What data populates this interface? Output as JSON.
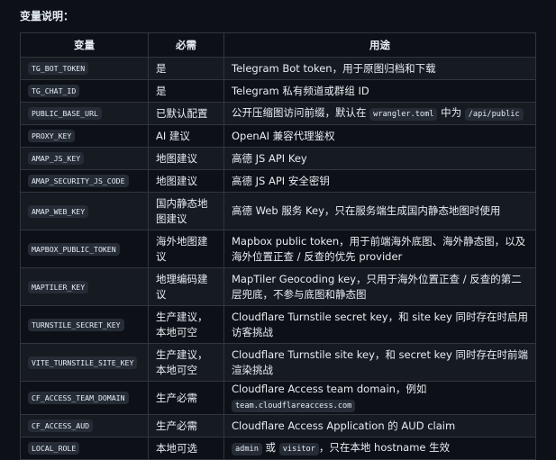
{
  "intro": "变量说明：",
  "headers": {
    "var": "变量",
    "req": "必需",
    "use": "用途"
  },
  "rows": [
    {
      "var": "TG_BOT_TOKEN",
      "req": "是",
      "use": [
        {
          "t": "Telegram Bot token，用于原图归档和下载"
        }
      ]
    },
    {
      "var": "TG_CHAT_ID",
      "req": "是",
      "use": [
        {
          "t": "Telegram 私有频道或群组 ID"
        }
      ]
    },
    {
      "var": "PUBLIC_BASE_URL",
      "req": "已默认配置",
      "use": [
        {
          "t": "公开压缩图访问前缀，默认在 "
        },
        {
          "c": "wrangler.toml"
        },
        {
          "t": " 中为 "
        },
        {
          "c": "/api/public"
        }
      ]
    },
    {
      "var": "PROXY_KEY",
      "req": "AI 建议",
      "use": [
        {
          "t": "OpenAI 兼容代理鉴权"
        }
      ]
    },
    {
      "var": "AMAP_JS_KEY",
      "req": "地图建议",
      "use": [
        {
          "t": "高德 JS API Key"
        }
      ]
    },
    {
      "var": "AMAP_SECURITY_JS_CODE",
      "req": "地图建议",
      "use": [
        {
          "t": "高德 JS API 安全密钥"
        }
      ]
    },
    {
      "var": "AMAP_WEB_KEY",
      "req": "国内静态地图建议",
      "use": [
        {
          "t": "高德 Web 服务 Key，只在服务端生成国内静态地图时使用"
        }
      ]
    },
    {
      "var": "MAPBOX_PUBLIC_TOKEN",
      "req": "海外地图建议",
      "use": [
        {
          "t": "Mapbox public token，用于前端海外底图、海外静态图，以及海外位置正查 / 反查的优先 provider"
        }
      ]
    },
    {
      "var": "MAPTILER_KEY",
      "req": "地理编码建议",
      "use": [
        {
          "t": "MapTiler Geocoding key，只用于海外位置正查 / 反查的第二层兜底，不参与底图和静态图"
        }
      ]
    },
    {
      "var": "TURNSTILE_SECRET_KEY",
      "req": "生产建议，本地可空",
      "use": [
        {
          "t": "Cloudflare Turnstile secret key，和 site key 同时存在时启用访客挑战"
        }
      ]
    },
    {
      "var": "VITE_TURNSTILE_SITE_KEY",
      "req": "生产建议，本地可空",
      "use": [
        {
          "t": "Cloudflare Turnstile site key，和 secret key 同时存在时前端渲染挑战"
        }
      ]
    },
    {
      "var": "CF_ACCESS_TEAM_DOMAIN",
      "req": "生产必需",
      "use": [
        {
          "t": "Cloudflare Access team domain，例如 "
        },
        {
          "c": "team.cloudflareaccess.com"
        }
      ]
    },
    {
      "var": "CF_ACCESS_AUD",
      "req": "生产必需",
      "use": [
        {
          "t": "Cloudflare Access Application 的 AUD claim"
        }
      ]
    },
    {
      "var": "LOCAL_ROLE",
      "req": "本地可选",
      "use": [
        {
          "c": "admin"
        },
        {
          "t": " 或 "
        },
        {
          "c": "visitor"
        },
        {
          "t": "，只在本地 hostname 生效"
        }
      ]
    }
  ]
}
